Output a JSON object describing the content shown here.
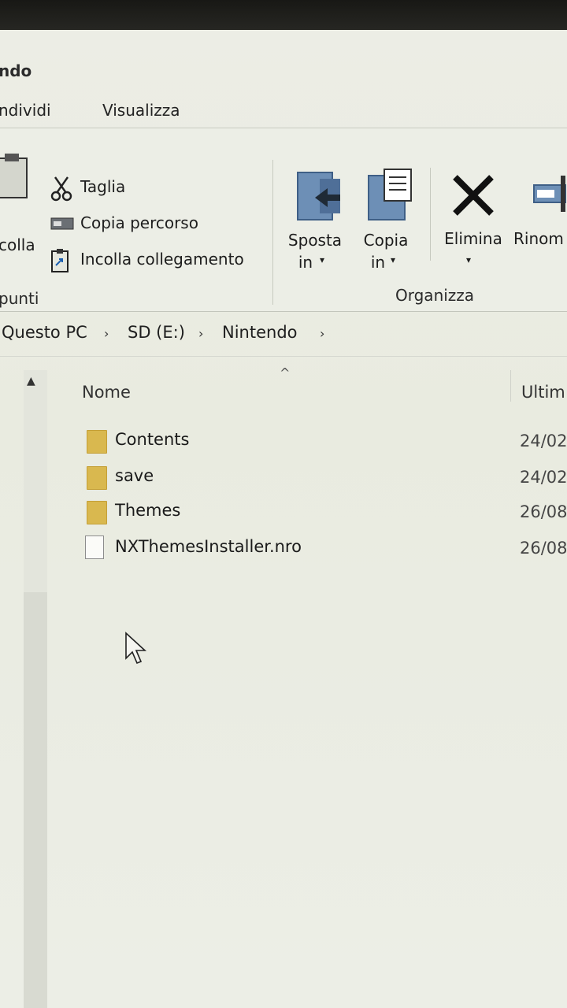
{
  "window": {
    "title_fragment": "ndo"
  },
  "menu": {
    "share": "ndividi",
    "view": "Visualizza"
  },
  "ribbon": {
    "clipboard": {
      "paste_fragment": "colla",
      "cut": "Taglia",
      "copy_path": "Copia percorso",
      "paste_shortcut": "Incolla collegamento",
      "group_label_fragment": "punti"
    },
    "organize": {
      "move_to_line1": "Sposta",
      "move_to_line2": "in",
      "copy_to_line1": "Copia",
      "copy_to_line2": "in",
      "delete": "Elimina",
      "rename_fragment": "Rinom",
      "group_label": "Organizza"
    }
  },
  "address": {
    "breadcrumbs": [
      "Questo PC",
      "SD (E:)",
      "Nintendo"
    ]
  },
  "file_list": {
    "columns": {
      "name": "Nome",
      "modified_fragment": "Ultim"
    },
    "items": [
      {
        "name": "Contents",
        "type": "folder",
        "date_fragment": "24/02"
      },
      {
        "name": "save",
        "type": "folder",
        "date_fragment": "24/02"
      },
      {
        "name": "Themes",
        "type": "folder",
        "date_fragment": "26/08"
      },
      {
        "name": "NXThemesInstaller.nro",
        "type": "file",
        "date_fragment": "26/08"
      }
    ]
  },
  "icons": {
    "cut": "scissors-icon",
    "copy_path": "copy-path-icon",
    "paste_shortcut": "paste-shortcut-icon",
    "move_to": "move-to-icon",
    "copy_to": "copy-to-icon",
    "delete": "delete-x-icon",
    "rename": "rename-icon",
    "folder": "folder-icon",
    "file": "file-icon"
  },
  "colors": {
    "folder": "#d9b84f",
    "background": "#eceee6"
  }
}
